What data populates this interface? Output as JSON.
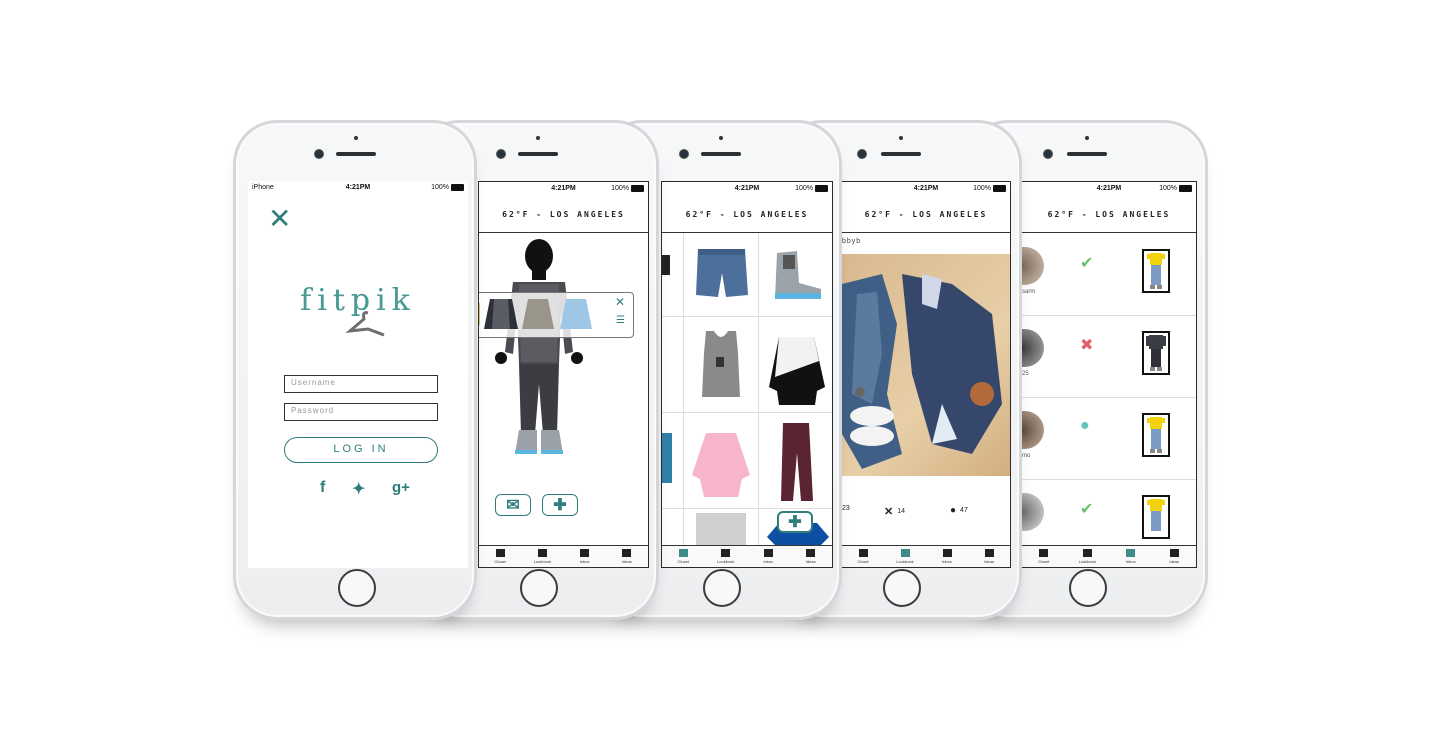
{
  "status_bar": {
    "carrier": "iPhone",
    "time": "4:21PM",
    "battery": "100%"
  },
  "weather": "62°F - LOS ANGELES",
  "login": {
    "close_icon": "close-icon",
    "logo_text": "fitpik",
    "username_placeholder": "Username",
    "password_placeholder": "Password",
    "login_button": "LOG IN",
    "social": [
      "f",
      "Twitter",
      "g+"
    ]
  },
  "tabs": [
    "Closet",
    "Lookbook",
    "Inbox",
    "Ideas"
  ],
  "closet": {
    "email_button": "email-icon",
    "add_button": "plus-icon"
  },
  "grid": {
    "add_button": "plus-icon"
  },
  "feed": {
    "username": "bbyb",
    "stats": {
      "likes": "23",
      "dislikes": "14",
      "comments": "47"
    }
  },
  "activity": {
    "rows": [
      {
        "username": "sarm",
        "status": "check-icon"
      },
      {
        "username": "25",
        "status": "x-icon"
      },
      {
        "username": "mo",
        "status": "comment-icon"
      },
      {
        "username": "",
        "status": "check-icon"
      }
    ]
  },
  "colors": {
    "accent": "#2f7e7c",
    "check": "#6ac46e",
    "cross": "#e35f6b",
    "comment": "#66c1be"
  }
}
